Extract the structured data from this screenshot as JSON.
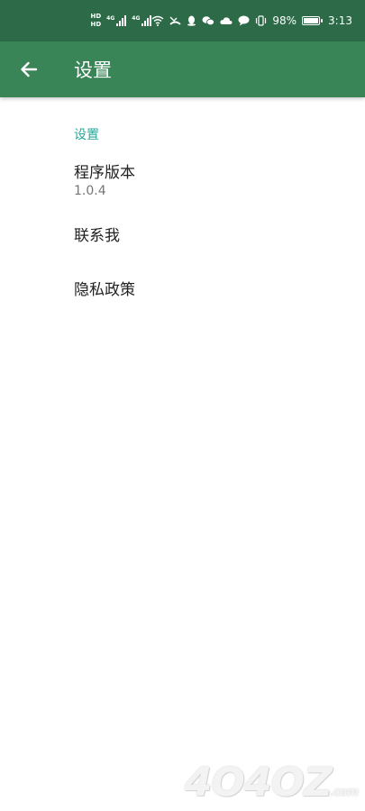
{
  "status_bar": {
    "hd_top": "HD",
    "hd_bottom": "HD",
    "net1_label": "4G",
    "net2_label": "4G",
    "battery_text": "98%",
    "battery_level": 0.98,
    "time": "3:13",
    "icons": [
      "wifi-icon",
      "missed-call-icon",
      "qq-icon",
      "wechat-icon",
      "cloud-icon",
      "message-icon",
      "vibrate-icon"
    ]
  },
  "app_bar": {
    "title": "设置",
    "back_icon": "arrow-back-icon"
  },
  "settings": {
    "section_title": "设置",
    "items": [
      {
        "title": "程序版本",
        "summary": "1.0.4"
      },
      {
        "title": "联系我"
      },
      {
        "title": "隐私政策"
      }
    ]
  },
  "watermark": {
    "text": "4O4OZ",
    "suffix": ".com"
  },
  "colors": {
    "status_bar": "#2c6a48",
    "app_bar": "#3a8557",
    "accent": "#26a69a"
  }
}
